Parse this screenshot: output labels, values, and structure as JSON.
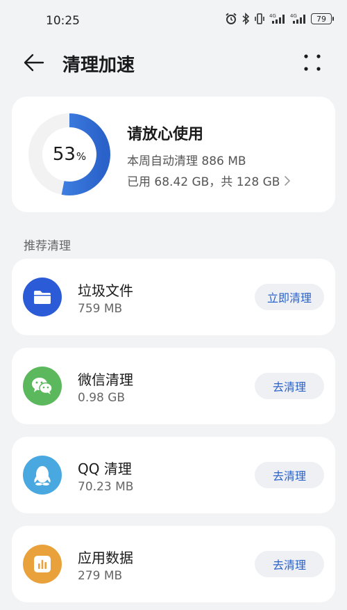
{
  "status_bar": {
    "time": "10:25",
    "battery": "79"
  },
  "header": {
    "title": "清理加速"
  },
  "summary": {
    "percent_value": "53",
    "percent_unit": "%",
    "percent_fraction": 0.53,
    "status": "请放心使用",
    "weekly_cleaned": "本周自动清理 886 MB",
    "storage": "已用 68.42 GB，共 128 GB"
  },
  "section_title": "推荐清理",
  "items": [
    {
      "name": "垃圾文件",
      "size": "759 MB",
      "button": "立即清理",
      "icon": "folder-icon",
      "color": "#2b5bd7"
    },
    {
      "name": "微信清理",
      "size": "0.98 GB",
      "button": "去清理",
      "icon": "wechat-icon",
      "color": "#5cb85c"
    },
    {
      "name": "QQ 清理",
      "size": "70.23 MB",
      "button": "去清理",
      "icon": "qq-icon",
      "color": "#4aa8e0"
    },
    {
      "name": "应用数据",
      "size": "279 MB",
      "button": "去清理",
      "icon": "app-data-icon",
      "color": "#e9a23b"
    }
  ],
  "colors": {
    "accent": "#2a62c9",
    "ring_start": "#4a90f0",
    "ring_end": "#2a62c9",
    "ring_track": "#f2f2f2"
  }
}
